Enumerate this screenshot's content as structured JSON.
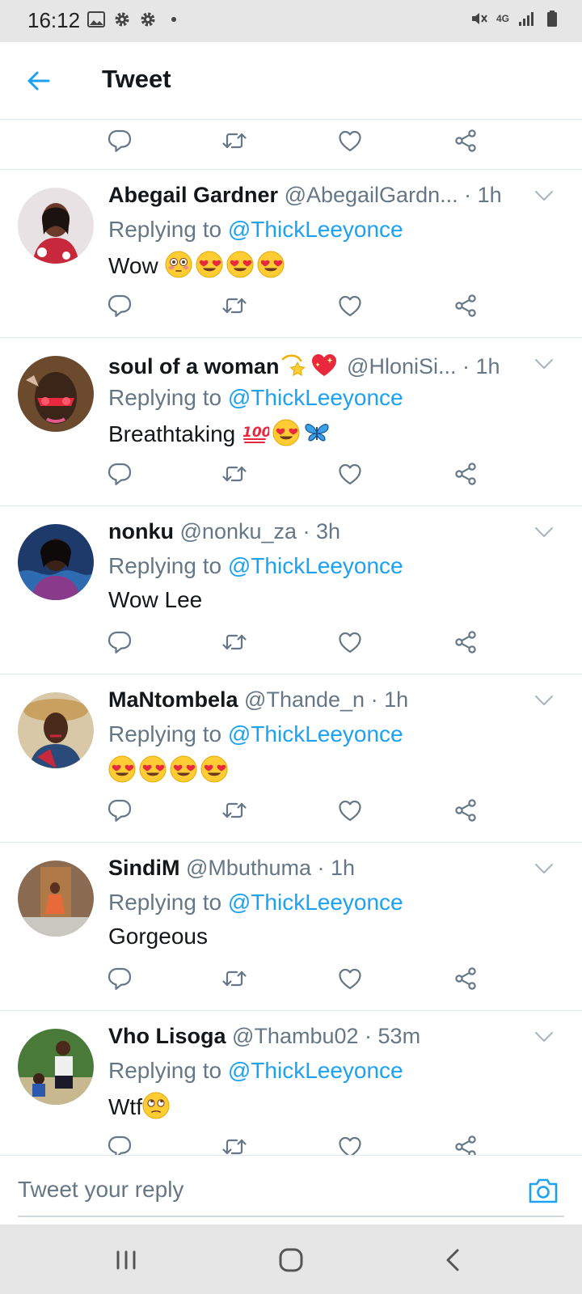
{
  "status_bar": {
    "time": "16:12",
    "network": "4G"
  },
  "header": {
    "back_icon": "arrow-left-icon",
    "title": "Tweet"
  },
  "colors": {
    "accent": "#1da1f2",
    "text": "#14171a",
    "secondary": "#657786",
    "divider": "#e1e8ed",
    "system_bar": "#e6e6e6"
  },
  "replies": [
    {
      "name": "Abegail Gardner",
      "handle": "@AbegailGardn...",
      "time": "· 1h",
      "replying_prefix": "Replying to ",
      "replying_to": "@ThickLeeyonce",
      "text": "Wow",
      "emojis": [
        "flushed-face",
        "heart-eyes",
        "heart-eyes",
        "heart-eyes"
      ]
    },
    {
      "name": "soul of a woman",
      "name_emojis": [
        "dizzy-star",
        "sparkling-heart"
      ],
      "handle": "@HloniSi...",
      "time": "· 1h",
      "replying_prefix": "Replying to ",
      "replying_to": "@ThickLeeyonce",
      "text": "Breathtaking",
      "emojis": [
        "hundred-points",
        "heart-eyes",
        "butterfly"
      ]
    },
    {
      "name": "nonku",
      "handle": "@nonku_za",
      "time": "· 3h",
      "replying_prefix": "Replying to ",
      "replying_to": "@ThickLeeyonce",
      "text": "Wow Lee",
      "emojis": []
    },
    {
      "name": "MaNtombela",
      "handle": "@Thande_n",
      "time": "· 1h",
      "replying_prefix": "Replying to ",
      "replying_to": "@ThickLeeyonce",
      "text": "",
      "emojis": [
        "heart-eyes",
        "heart-eyes",
        "heart-eyes",
        "heart-eyes"
      ]
    },
    {
      "name": "SindiM",
      "handle": "@Mbuthuma",
      "time": "· 1h",
      "replying_prefix": "Replying to ",
      "replying_to": "@ThickLeeyonce",
      "text": "Gorgeous",
      "emojis": []
    },
    {
      "name": "Vho Lisoga",
      "handle": "@Thambu02",
      "time": "· 53m",
      "replying_prefix": "Replying to ",
      "replying_to": "@ThickLeeyonce",
      "text": "Wtf",
      "emojis": [
        "rolling-eyes"
      ]
    }
  ],
  "reply_bar": {
    "placeholder": "Tweet your reply",
    "camera_icon": "camera-icon"
  },
  "nav_bar": {
    "recents_icon": "recents-icon",
    "home_icon": "home-icon",
    "back_icon": "back-chevron-icon"
  }
}
